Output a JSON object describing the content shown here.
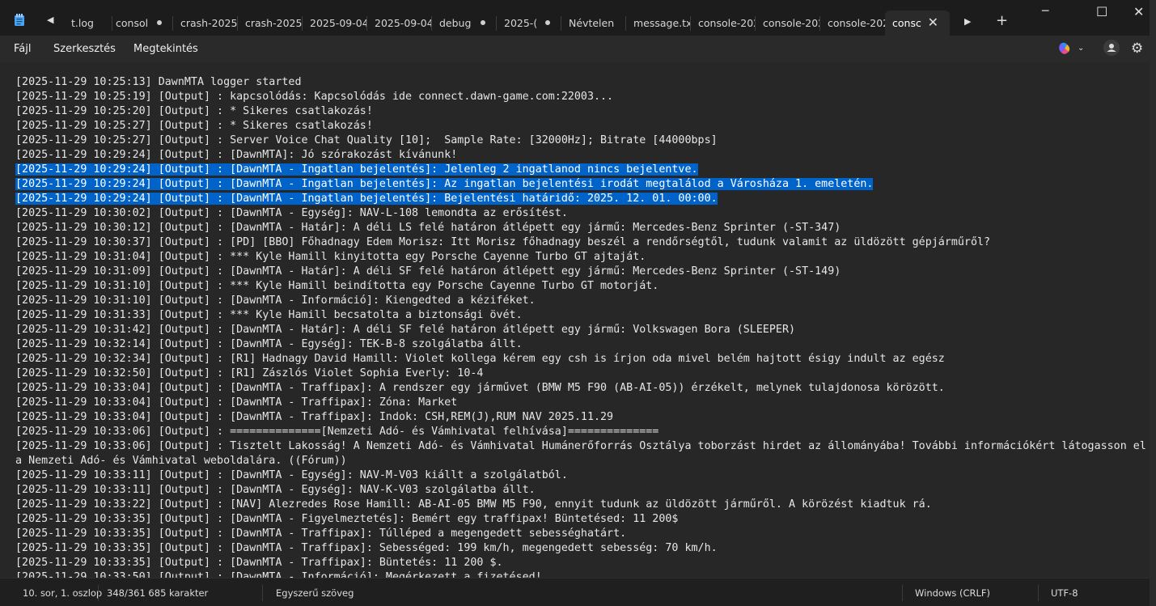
{
  "tabs": [
    {
      "label": "t.log",
      "dirty": false
    },
    {
      "label": "consol",
      "dirty": true
    },
    {
      "label": "crash-2025-(",
      "dirty": false
    },
    {
      "label": "crash-2025-(",
      "dirty": false
    },
    {
      "label": "2025-09-04-",
      "dirty": false
    },
    {
      "label": "2025-09-04-",
      "dirty": false
    },
    {
      "label": "debug",
      "dirty": true
    },
    {
      "label": "2025-(",
      "dirty": true
    },
    {
      "label": "Névtelen",
      "dirty": false
    },
    {
      "label": "message.txt",
      "dirty": false
    },
    {
      "label": "console-202",
      "dirty": false
    },
    {
      "label": "console-202",
      "dirty": false
    },
    {
      "label": "console-202",
      "dirty": false
    },
    {
      "label": "consc",
      "dirty": false,
      "active": true
    }
  ],
  "menu": {
    "file": "Fájl",
    "edit": "Szerkesztés",
    "view": "Megtekintés"
  },
  "editor": {
    "lines": [
      "[2025-11-29 10:25:13] DawnMTA logger started",
      "[2025-11-29 10:25:19] [Output] : kapcsolódás: Kapcsolódás ide connect.dawn-game.com:22003...",
      "[2025-11-29 10:25:20] [Output] : * Sikeres csatlakozás!",
      "[2025-11-29 10:25:27] [Output] : * Sikeres csatlakozás!",
      "[2025-11-29 10:25:27] [Output] : Server Voice Chat Quality [10];  Sample Rate: [32000Hz]; Bitrate [44000bps]",
      "[2025-11-29 10:29:24] [Output] : [DawnMTA]: Jó szórakozást kívánunk!",
      "[2025-11-29 10:29:24] [Output] : [DawnMTA - Ingatlan bejelentés]: Jelenleg 2 ingatlanod nincs bejelentve.",
      "[2025-11-29 10:29:24] [Output] : [DawnMTA - Ingatlan bejelentés]: Az ingatlan bejelentési irodát megtalálod a Városháza 1. emeletén.",
      "[2025-11-29 10:29:24] [Output] : [DawnMTA - Ingatlan bejelentés]: Bejelentési határidő: 2025. 12. 01. 00:00.",
      "[2025-11-29 10:30:02] [Output] : [DawnMTA - Egység]: NAV-L-108 lemondta az erősítést.",
      "[2025-11-29 10:30:12] [Output] : [DawnMTA - Határ]: A déli LS felé határon átlépett egy jármű: Mercedes-Benz Sprinter (-ST-347)",
      "[2025-11-29 10:30:37] [Output] : [PD] [BBO] Főhadnagy Edem Morisz: Itt Morisz főhadnagy beszél a rendőrségtől, tudunk valamit az üldözött gépjárműről?",
      "[2025-11-29 10:31:04] [Output] : *** Kyle Hamill kinyitotta egy Porsche Cayenne Turbo GT ajtaját.",
      "[2025-11-29 10:31:09] [Output] : [DawnMTA - Határ]: A déli SF felé határon átlépett egy jármű: Mercedes-Benz Sprinter (-ST-149)",
      "[2025-11-29 10:31:10] [Output] : *** Kyle Hamill beindította egy Porsche Cayenne Turbo GT motorját.",
      "[2025-11-29 10:31:10] [Output] : [DawnMTA - Információ]: Kiengedted a kéziféket.",
      "[2025-11-29 10:31:33] [Output] : *** Kyle Hamill becsatolta a biztonsági övét.",
      "[2025-11-29 10:31:42] [Output] : [DawnMTA - Határ]: A déli SF felé határon átlépett egy jármű: Volkswagen Bora (SLEEPER)",
      "[2025-11-29 10:32:14] [Output] : [DawnMTA - Egység]: TEK-B-8 szolgálatba állt.",
      "[2025-11-29 10:32:34] [Output] : [R1] Hadnagy David Hamill: Violet kollega kérem egy csh is írjon oda mivel belém hajtott ésigy indult az egész",
      "[2025-11-29 10:32:50] [Output] : [R1] Zászlós Violet Sophia Everly: 10-4",
      "[2025-11-29 10:33:04] [Output] : [DawnMTA - Traffipax]: A rendszer egy járművet (BMW M5 F90 (AB-AI-05)) érzékelt, melynek tulajdonosa körözött.",
      "[2025-11-29 10:33:04] [Output] : [DawnMTA - Traffipax]: Zóna: Market",
      "[2025-11-29 10:33:04] [Output] : [DawnMTA - Traffipax]: Indok: CSH,REM(J),RUM NAV 2025.11.29",
      "[2025-11-29 10:33:06] [Output] : ==============[Nemzeti Adó- és Vámhivatal felhívása]==============",
      "[2025-11-29 10:33:06] [Output] : Tisztelt Lakosság! A Nemzeti Adó- és Vámhivatal Humánerőforrás Osztálya toborzást hirdet az állományába! További információkért látogasson el",
      "a Nemzeti Adó- és Vámhivatal weboldalára. ((Fórum))",
      "[2025-11-29 10:33:11] [Output] : [DawnMTA - Egység]: NAV-M-V03 kiállt a szolgálatból.",
      "[2025-11-29 10:33:11] [Output] : [DawnMTA - Egység]: NAV-K-V03 szolgálatba állt.",
      "[2025-11-29 10:33:22] [Output] : [NAV] Alezredes Rose Hamill: AB-AI-05 BMW M5 F90, ennyit tudunk az üldözött járműről. A körözést kiadtuk rá.",
      "[2025-11-29 10:33:35] [Output] : [DawnMTA - Figyelmeztetés]: Bemért egy traffipax! Büntetésed: 11 200$",
      "[2025-11-29 10:33:35] [Output] : [DawnMTA - Traffipax]: Túlléped a megengedett sebességhatárt.",
      "[2025-11-29 10:33:35] [Output] : [DawnMTA - Traffipax]: Sebességed: 199 km/h, megengedett sebesség: 70 km/h.",
      "[2025-11-29 10:33:35] [Output] : [DawnMTA - Traffipax]: Büntetés: 11 200 $.",
      "[2025-11-29 10:33:50] [Output] : [DawnMTA - Információ]: Megérkezett a fizetésed!"
    ],
    "selected_lines": [
      6,
      7,
      8
    ]
  },
  "status": {
    "position": "10. sor, 1. oszlop",
    "chars": "348/361 685 karakter",
    "format": "Egyszerű szöveg",
    "line_ending": "Windows (CRLF)",
    "encoding": "UTF-8"
  }
}
